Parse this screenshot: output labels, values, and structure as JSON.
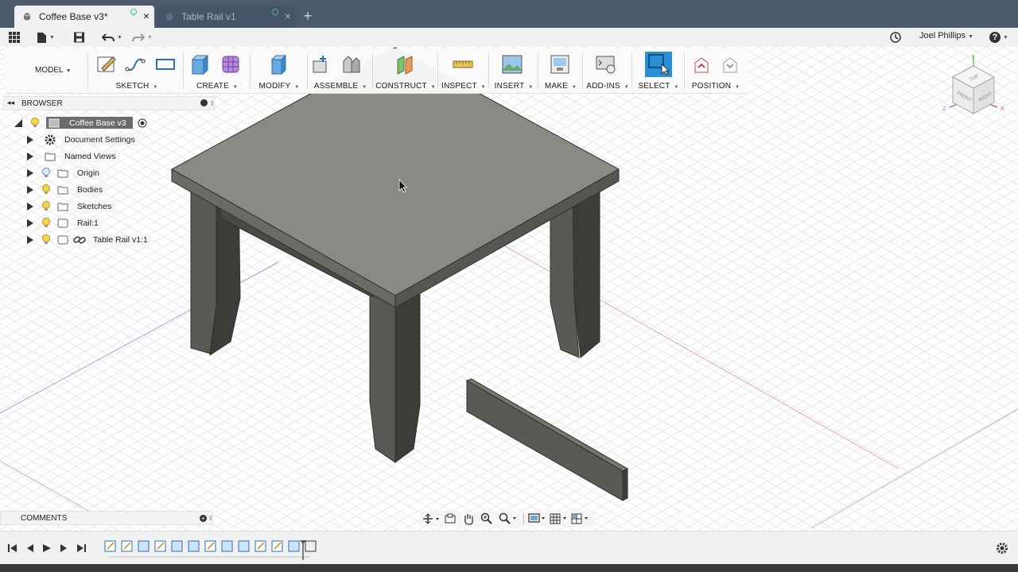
{
  "tabs": [
    {
      "label": "Coffee Base v3*",
      "active": true
    },
    {
      "label": "Table Rail v1",
      "active": false
    }
  ],
  "new_tab": "+",
  "user": {
    "name": "Joel Phillips"
  },
  "help": "?",
  "workspace": {
    "label": "MODEL"
  },
  "ribbon": {
    "groups": [
      {
        "label": "SKETCH"
      },
      {
        "label": "CREATE"
      },
      {
        "label": "MODIFY"
      },
      {
        "label": "ASSEMBLE"
      },
      {
        "label": "CONSTRUCT"
      },
      {
        "label": "INSPECT"
      },
      {
        "label": "INSERT"
      },
      {
        "label": "MAKE"
      },
      {
        "label": "ADD-INS"
      },
      {
        "label": "SELECT"
      },
      {
        "label": "POSITION"
      }
    ]
  },
  "browser": {
    "title": "BROWSER",
    "root": "Coffee Base v3",
    "items": [
      {
        "label": "Document Settings",
        "icon": "gear-icon"
      },
      {
        "label": "Named Views",
        "icon": "folder-icon"
      },
      {
        "label": "Origin",
        "icon": "folder-icon"
      },
      {
        "label": "Bodies",
        "icon": "folder-icon"
      },
      {
        "label": "Sketches",
        "icon": "folder-icon"
      },
      {
        "label": "Rail:1",
        "icon": "component-icon"
      },
      {
        "label": "Table Rail v1:1",
        "icon": "link-icon"
      }
    ]
  },
  "comments": {
    "title": "COMMENTS"
  },
  "viewcube": {
    "top": "TOP",
    "front": "FRONT",
    "right": "RIGHT",
    "x": "X",
    "y": "Y",
    "z": "Z"
  },
  "colors": {
    "tabbar": "#4c5a6c",
    "model_top": "#8a8884",
    "model_side": "#5c5b57",
    "select_blue": "#2b8fd6"
  }
}
